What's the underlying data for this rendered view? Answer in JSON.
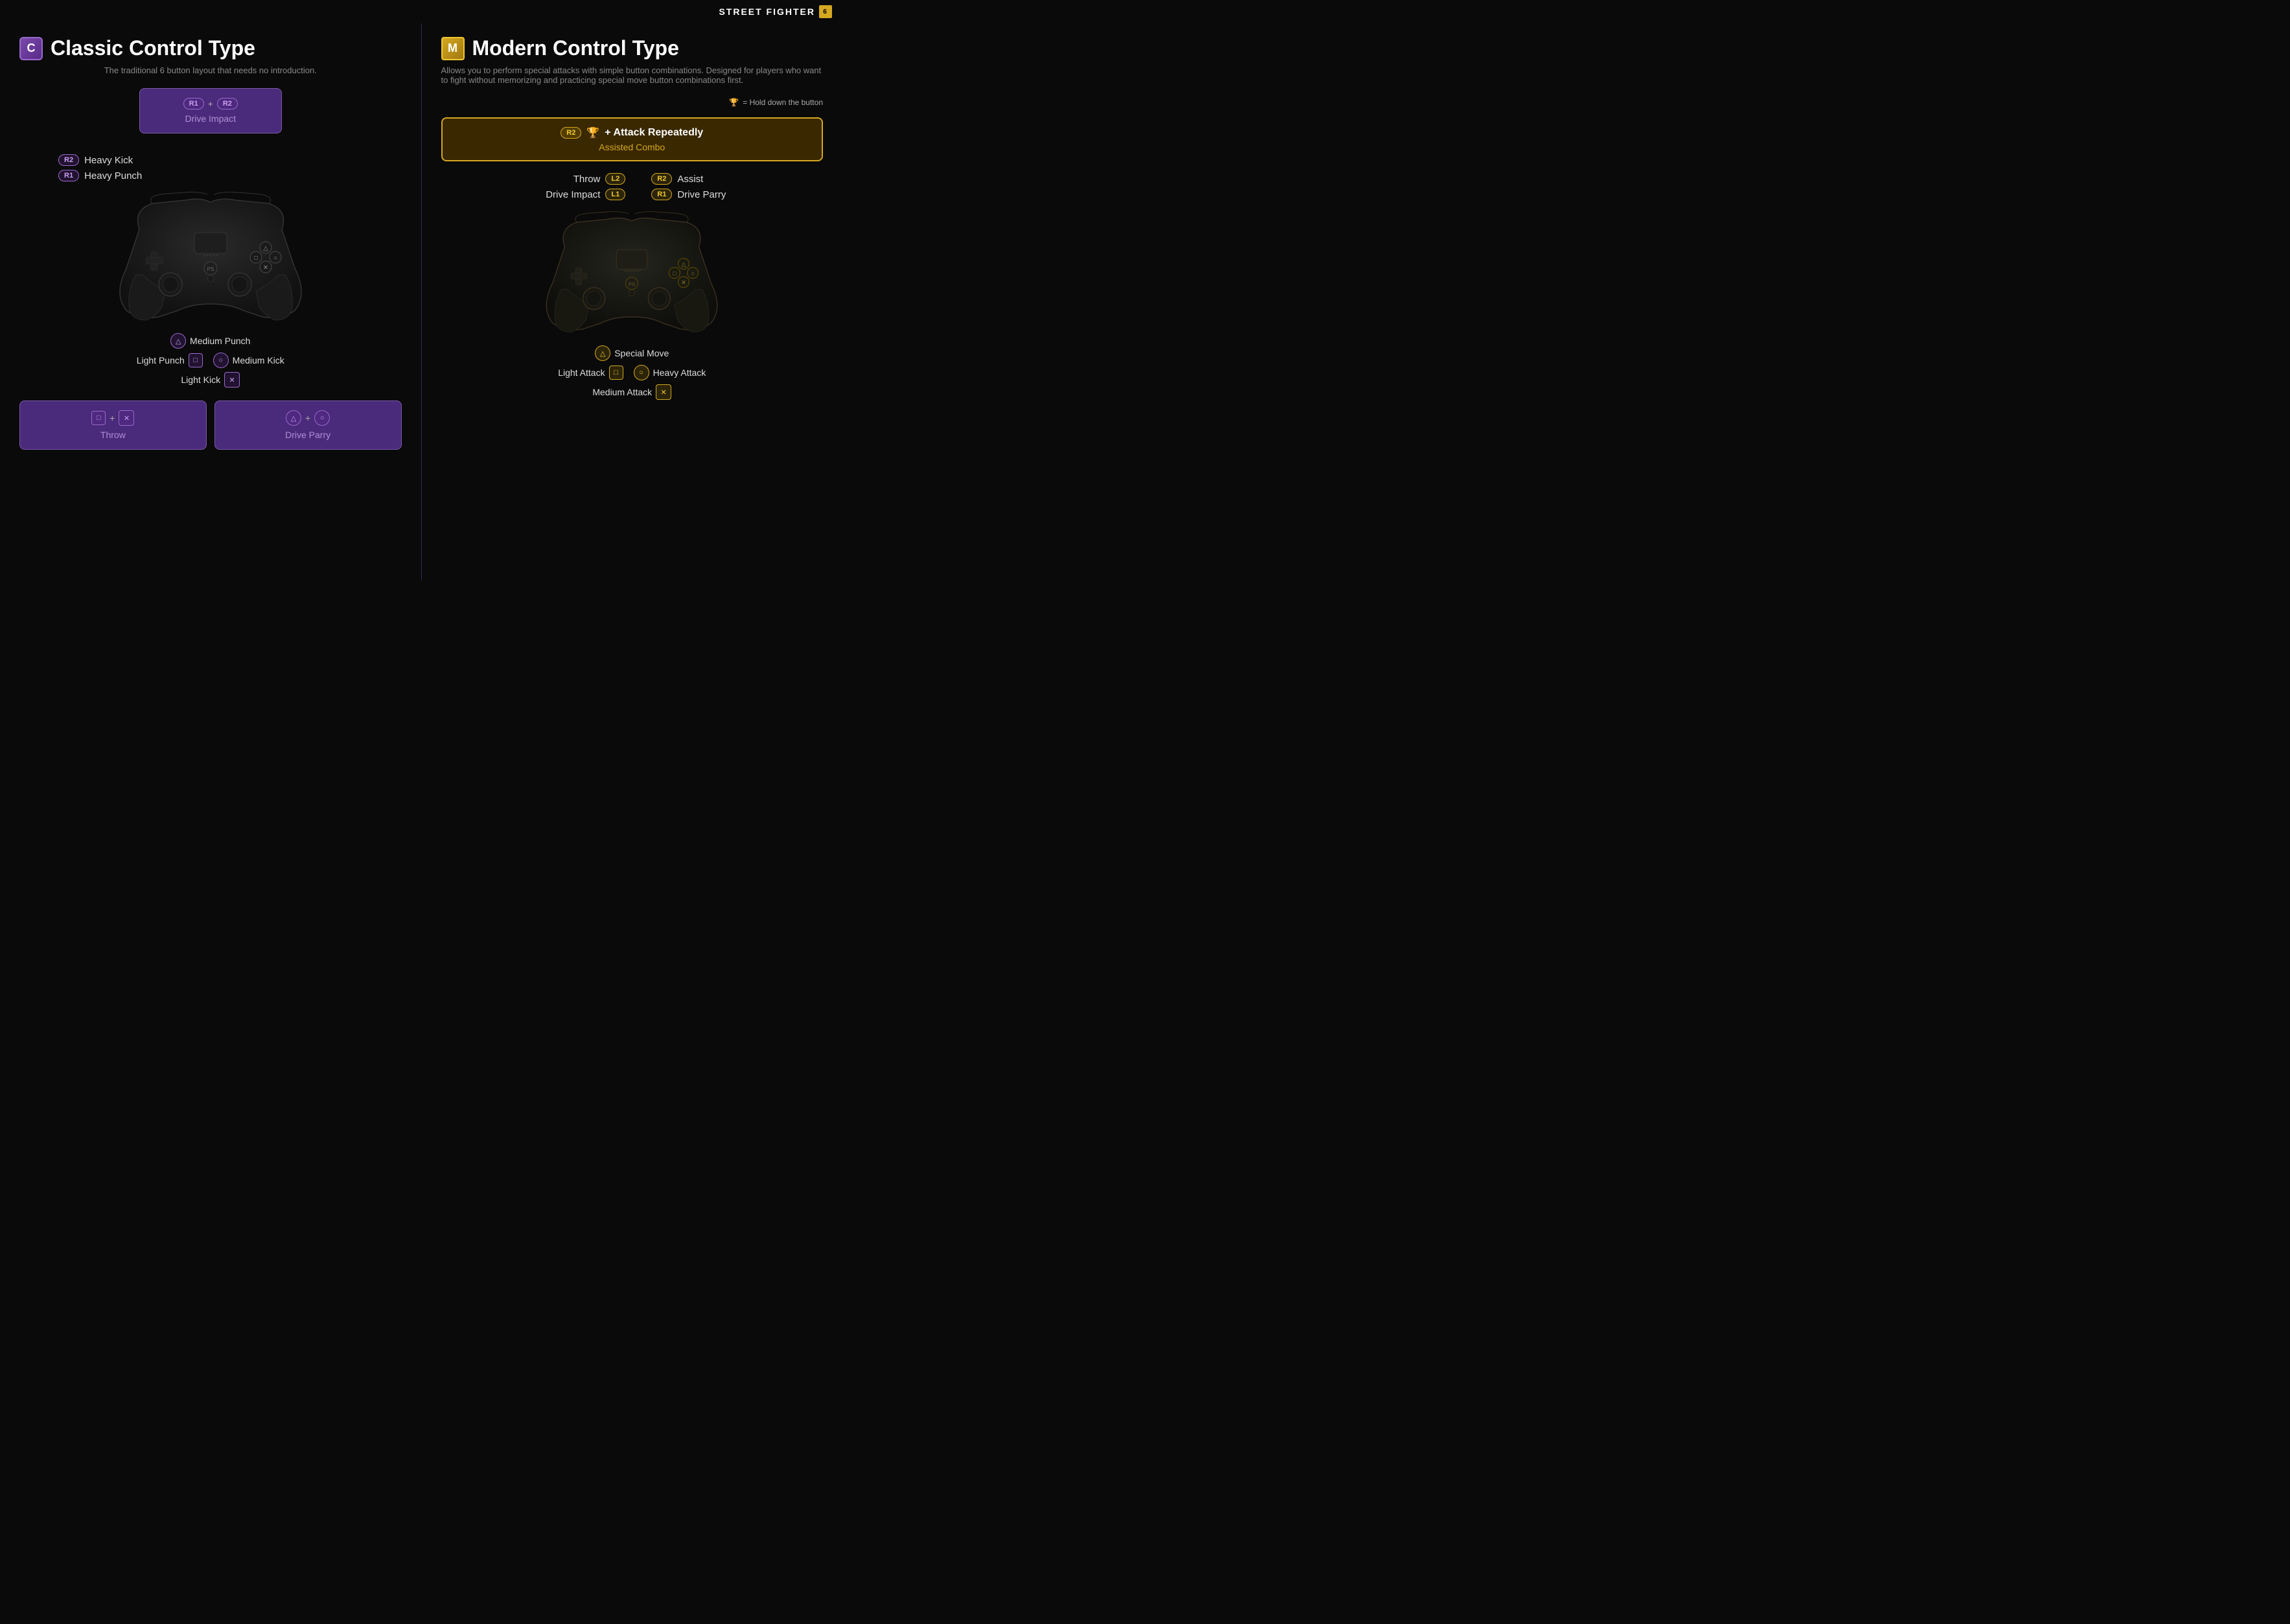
{
  "brand": {
    "name": "STREET FIGHTER",
    "icon": "6"
  },
  "classic": {
    "badge": "C",
    "title": "Classic Control Type",
    "subtitle": "The traditional 6 button layout that needs no introduction.",
    "drive_impact": {
      "label": "Drive Impact",
      "key1": "R1",
      "key2": "R2",
      "plus": "+"
    },
    "triggers": [
      {
        "badge": "R2",
        "label": "Heavy Kick"
      },
      {
        "badge": "R1",
        "label": "Heavy Punch"
      }
    ],
    "face_buttons": {
      "triangle": {
        "symbol": "△",
        "label": "Medium Punch"
      },
      "square": {
        "symbol": "□",
        "label": "Light Punch"
      },
      "circle": {
        "symbol": "○",
        "label": "Medium Kick"
      },
      "cross": {
        "symbol": "✕",
        "label": "Light Kick"
      }
    },
    "combos": [
      {
        "key1_symbol": "□",
        "key1_badge": "square",
        "plus": "+",
        "key2_symbol": "✕",
        "key2_badge": "cross",
        "label": "Throw"
      },
      {
        "key1_symbol": "△",
        "key1_badge": "triangle",
        "plus": "+",
        "key2_symbol": "○",
        "key2_badge": "circle",
        "label": "Drive Parry"
      }
    ]
  },
  "modern": {
    "badge": "M",
    "title": "Modern Control Type",
    "subtitle": "Allows you to perform special attacks with simple button combinations. Designed for players who want to fight without memorizing and practicing special move button combinations first.",
    "hold_note": "= Hold down the button",
    "assisted_combo": {
      "badge": "R2",
      "trophy": "🏆",
      "label": "+ Attack Repeatedly",
      "sublabel": "Assisted Combo"
    },
    "left_triggers": [
      {
        "label": "Throw",
        "badge": "L2"
      },
      {
        "label": "Drive Impact",
        "badge": "L1"
      }
    ],
    "right_triggers": [
      {
        "badge": "R2",
        "label": "Assist"
      },
      {
        "badge": "R1",
        "label": "Drive Parry"
      }
    ],
    "face_buttons": {
      "triangle": {
        "symbol": "△",
        "label": "Special Move"
      },
      "square": {
        "symbol": "□",
        "label": "Light Attack"
      },
      "circle": {
        "symbol": "○",
        "label": "Heavy Attack"
      },
      "cross": {
        "symbol": "✕",
        "label": "Medium Attack"
      }
    }
  }
}
